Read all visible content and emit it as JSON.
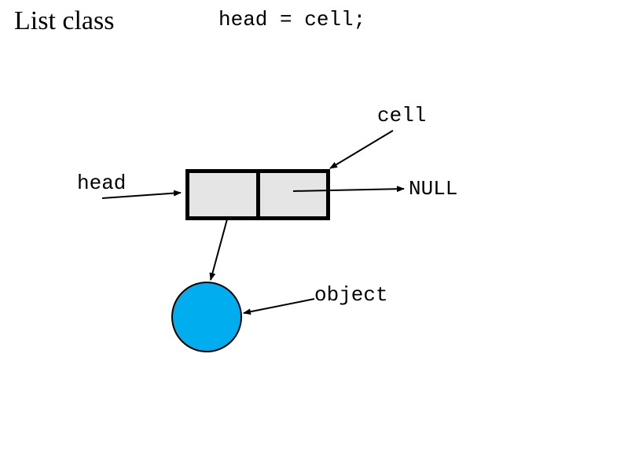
{
  "title": "List class",
  "code_line": "head = cell;",
  "labels": {
    "cell": "cell",
    "head": "head",
    "null": "NULL",
    "object": "object"
  }
}
